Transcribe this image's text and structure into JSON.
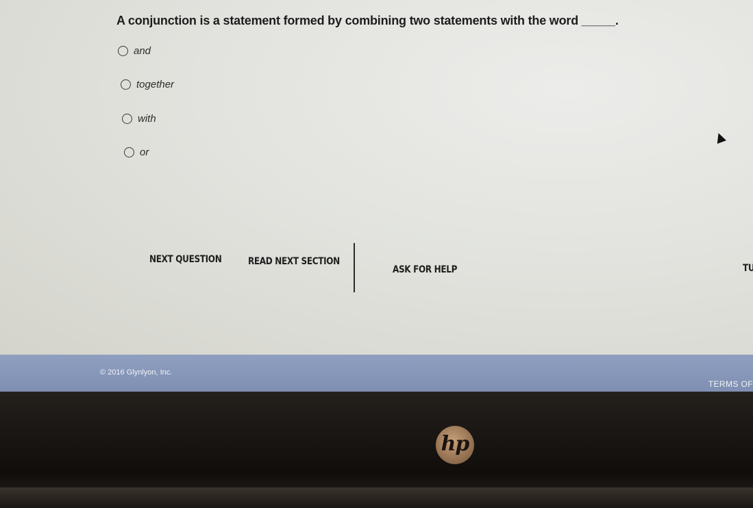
{
  "question": {
    "text": "A conjunction is a statement formed by combining two statements with the word _____."
  },
  "options": [
    {
      "label": "and"
    },
    {
      "label": "together"
    },
    {
      "label": "with"
    },
    {
      "label": "or"
    }
  ],
  "actions": {
    "next_question": "NEXT QUESTION",
    "read_next_section": "READ NEXT SECTION",
    "ask_for_help": "ASK FOR HELP",
    "truncated": "TU"
  },
  "footer": {
    "copyright": "© 2016 Glynlyon, Inc.",
    "terms": "TERMS OF"
  },
  "device": {
    "logo": "hp"
  },
  "colors": {
    "footer_bg": "#8596b8",
    "screen_bg": "#e2e3de",
    "bezel": "#1a1512"
  }
}
